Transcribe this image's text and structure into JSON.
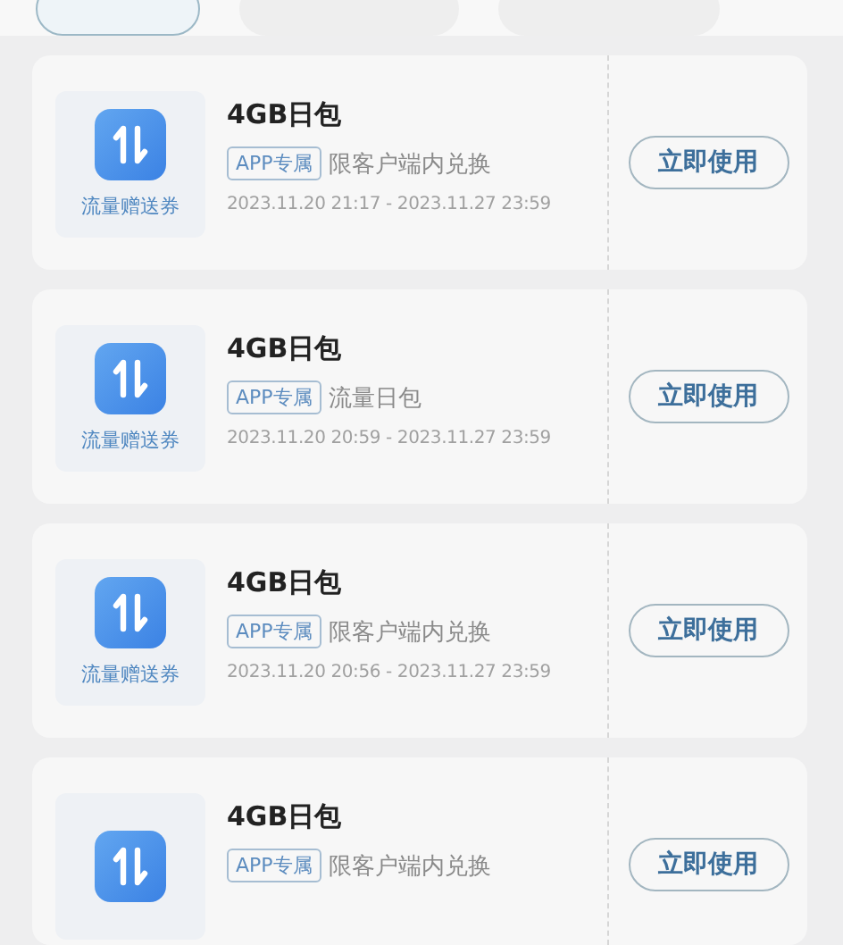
{
  "tabs": [
    {
      "selected": true
    },
    {
      "selected": false
    },
    {
      "selected": false
    }
  ],
  "coupons": [
    {
      "badge_label": "流量赠送券",
      "title": "4GB日包",
      "tag": "APP专属",
      "description": "限客户端内兑换",
      "validity": "2023.11.20 21:17 - 2023.11.27 23:59",
      "action": "立即使用"
    },
    {
      "badge_label": "流量赠送券",
      "title": "4GB日包",
      "tag": "APP专属",
      "description": "流量日包",
      "validity": "2023.11.20 20:59 - 2023.11.27 23:59",
      "action": "立即使用"
    },
    {
      "badge_label": "流量赠送券",
      "title": "4GB日包",
      "tag": "APP专属",
      "description": "限客户端内兑换",
      "validity": "2023.11.20 20:56 - 2023.11.27 23:59",
      "action": "立即使用"
    },
    {
      "title": "4GB日包",
      "tag": "APP专属",
      "description": "限客户端内兑换",
      "action": "立即使用"
    }
  ]
}
